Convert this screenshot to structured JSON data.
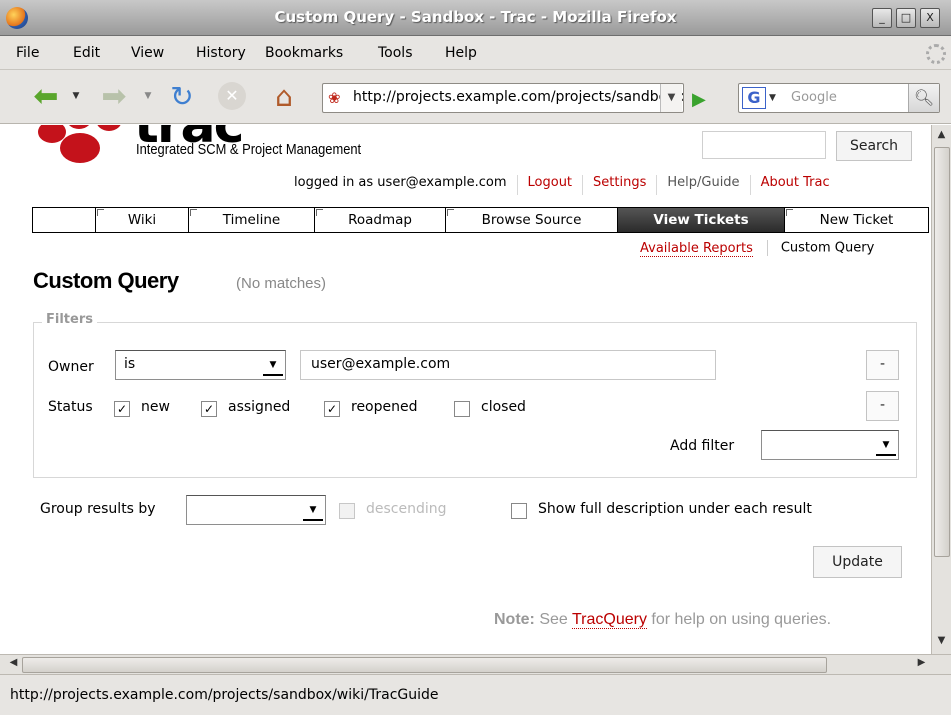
{
  "window": {
    "title": "Custom Query - Sandbox - Trac - Mozilla Firefox",
    "buttons": {
      "minimize": "_",
      "maximize": "□",
      "close": "X"
    }
  },
  "menu": [
    "File",
    "Edit",
    "View",
    "History",
    "Bookmarks",
    "Tools",
    "Help"
  ],
  "nav": {
    "url": "http://projects.example.com/projects/sandbox/query",
    "search_placeholder": "Google",
    "search_engine": "G"
  },
  "status_bar": "http://projects.example.com/projects/sandbox/wiki/TracGuide",
  "page": {
    "logo": {
      "word": "trac",
      "tagline": "Integrated SCM & Project Management"
    },
    "search_button": "Search",
    "metanav": {
      "logged_in": "logged in as user@example.com",
      "logout": "Logout",
      "settings": "Settings",
      "help": "Help/Guide",
      "about": "About Trac"
    },
    "mainnav": [
      "",
      "Wiki",
      "Timeline",
      "Roadmap",
      "Browse Source",
      "View Tickets",
      "New Ticket"
    ],
    "active_tab": "View Tickets",
    "ctxnav": {
      "reports": "Available Reports",
      "custom_query": "Custom Query"
    },
    "title": "Custom Query",
    "match_count": "(No matches)",
    "filters": {
      "legend": "Filters",
      "owner": {
        "label": "Owner",
        "mode": "is",
        "value": "user@example.com",
        "remove": "-"
      },
      "status": {
        "label": "Status",
        "options": [
          {
            "label": "new",
            "checked": true
          },
          {
            "label": "assigned",
            "checked": true
          },
          {
            "label": "reopened",
            "checked": true
          },
          {
            "label": "closed",
            "checked": false
          }
        ],
        "remove": "-"
      },
      "add_filter": {
        "label": "Add filter",
        "value": ""
      }
    },
    "group_by": {
      "label": "Group results by",
      "value": "",
      "descending": "descending"
    },
    "full_description": "Show full description under each result",
    "update_button": "Update",
    "note": {
      "prefix": "Note:",
      "see": "See",
      "link": "TracQuery",
      "suffix": "for help on using queries."
    }
  }
}
